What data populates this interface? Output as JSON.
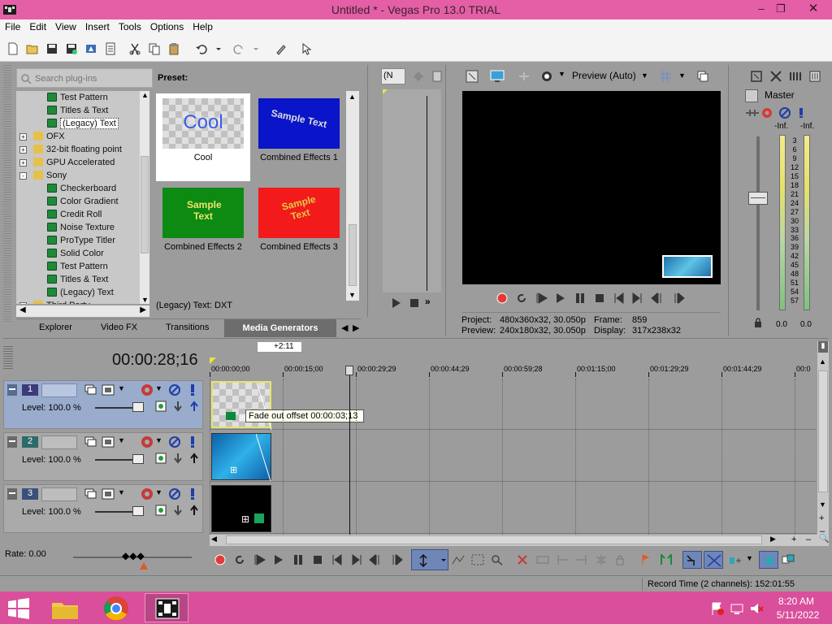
{
  "window": {
    "title": "Untitled * - Vegas Pro 13.0 TRIAL"
  },
  "menu": [
    "File",
    "Edit",
    "View",
    "Insert",
    "Tools",
    "Options",
    "Help"
  ],
  "plugins": {
    "search_placeholder": "Search plug-ins",
    "tree": [
      {
        "label": "Test Pattern",
        "indent": 2,
        "type": "plugin"
      },
      {
        "label": "Titles & Text",
        "indent": 2,
        "type": "plugin"
      },
      {
        "label": "(Legacy) Text",
        "indent": 2,
        "type": "plugin",
        "selected": true
      },
      {
        "label": "OFX",
        "indent": 1,
        "type": "folder",
        "expander": "+"
      },
      {
        "label": "32-bit floating point",
        "indent": 1,
        "type": "folder",
        "expander": "+"
      },
      {
        "label": "GPU Accelerated",
        "indent": 1,
        "type": "folder",
        "expander": "+"
      },
      {
        "label": "Sony",
        "indent": 1,
        "type": "folder",
        "expander": "-"
      },
      {
        "label": "Checkerboard",
        "indent": 2,
        "type": "plugin"
      },
      {
        "label": "Color Gradient",
        "indent": 2,
        "type": "plugin"
      },
      {
        "label": "Credit Roll",
        "indent": 2,
        "type": "plugin"
      },
      {
        "label": "Noise Texture",
        "indent": 2,
        "type": "plugin"
      },
      {
        "label": "ProType Titler",
        "indent": 2,
        "type": "plugin"
      },
      {
        "label": "Solid Color",
        "indent": 2,
        "type": "plugin"
      },
      {
        "label": "Test Pattern",
        "indent": 2,
        "type": "plugin"
      },
      {
        "label": "Titles & Text",
        "indent": 2,
        "type": "plugin"
      },
      {
        "label": "(Legacy) Text",
        "indent": 2,
        "type": "plugin"
      },
      {
        "label": "Third Party",
        "indent": 1,
        "type": "folder",
        "expander": "+"
      }
    ],
    "preset_label": "Preset:",
    "presets": [
      {
        "name": "Cool",
        "thumb_text": "Cool",
        "selected": true
      },
      {
        "name": "Combined Effects 1",
        "thumb_text": "Sample Text"
      },
      {
        "name": "Combined Effects 2",
        "thumb_text": "Sample Text"
      },
      {
        "name": "Combined Effects 3",
        "thumb_text": "Sample Text"
      }
    ],
    "status": "(Legacy) Text: DXT",
    "tabs": [
      "Explorer",
      "Video FX",
      "Transitions",
      "Media Generators"
    ],
    "active_tab": "Media Generators"
  },
  "trimmer": {
    "dropdown": "(N"
  },
  "preview": {
    "mode": "Preview (Auto)",
    "project_label": "Project:",
    "project_value": "480x360x32, 30.050p",
    "frame_label": "Frame:",
    "frame_value": "859",
    "preview_label": "Preview:",
    "preview_value": "240x180x32, 30.050p",
    "display_label": "Display:",
    "display_value": "317x238x32"
  },
  "master": {
    "title": "Master",
    "inf_left": "-Inf.",
    "inf_right": "-Inf.",
    "scale": [
      "3",
      "6",
      "9",
      "12",
      "15",
      "18",
      "21",
      "24",
      "27",
      "30",
      "33",
      "36",
      "39",
      "42",
      "45",
      "48",
      "51",
      "54",
      "57"
    ],
    "readout_left": "0.0",
    "readout_right": "0.0"
  },
  "timeline": {
    "timecode": "00:00:28;16",
    "marker": "+2:11",
    "ruler": [
      "00:00:00;00",
      "00:00:15;00",
      "00:00:29;29",
      "00:00:44;29",
      "00:00:59;28",
      "00:01:15;00",
      "00:01:29;29",
      "00:01:44;29",
      "00:0"
    ],
    "tracks": [
      {
        "number": "1",
        "level_label": "Level: 100.0 %"
      },
      {
        "number": "2",
        "level_label": "Level: 100.0 %"
      },
      {
        "number": "3",
        "level_label": "Level: 100.0 %"
      }
    ],
    "tooltip": "Fade out offset 00:00:03;13",
    "rate": "Rate: 0.00"
  },
  "status": {
    "record_time": "Record Time (2 channels): 152:01:55"
  },
  "taskbar": {
    "time": "8:20 AM",
    "date": "5/11/2022"
  },
  "colors": {
    "titlebar": "#e45fa6",
    "taskbar": "#d94f9b",
    "panel": "#9c9c9c",
    "selected_track": "#9aaccc"
  }
}
